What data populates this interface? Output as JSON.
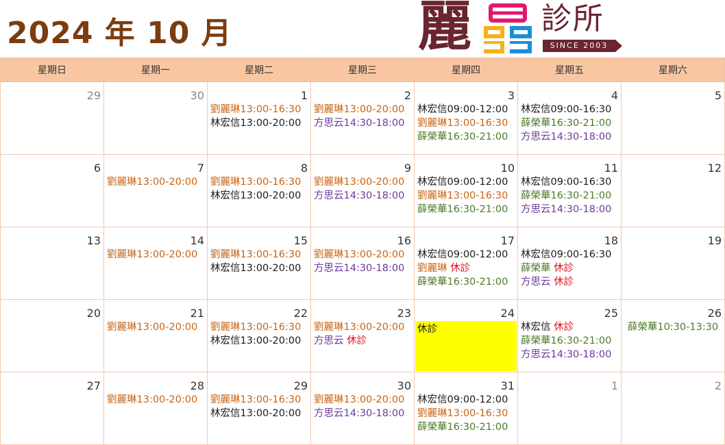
{
  "header": {
    "title": "2024 年 10 月",
    "logo": {
      "char1": "麗",
      "char2": "診所",
      "since": "SINCE 2003"
    }
  },
  "weekdays": [
    "星期日",
    "星期一",
    "星期二",
    "星期三",
    "星期四",
    "星期五",
    "星期六"
  ],
  "colors": {
    "liu": "#c86414",
    "lin": "#1a1a1a",
    "xue": "#4e7a2a",
    "fang": "#6a3a9a",
    "off": "#e0101c",
    "header_bg": "#f8c7a2",
    "title": "#7a3d10",
    "highlight": "#ffff00"
  },
  "weeks": [
    [
      {
        "day": "29",
        "other": true,
        "entries": []
      },
      {
        "day": "30",
        "other": true,
        "entries": []
      },
      {
        "day": "1",
        "entries": [
          {
            "name": "劉麗琳13:00-16:30",
            "c": "liu"
          },
          {
            "name": "林宏信13:00-20:00",
            "c": "lin"
          }
        ]
      },
      {
        "day": "2",
        "entries": [
          {
            "name": "劉麗琳13:00-20:00",
            "c": "liu"
          },
          {
            "name": "方思云14:30-18:00",
            "c": "fang"
          }
        ]
      },
      {
        "day": "3",
        "entries": [
          {
            "name": "林宏信09:00-12:00",
            "c": "lin"
          },
          {
            "name": "劉麗琳13:00-16:30",
            "c": "liu"
          },
          {
            "name": "薛榮華16:30-21:00",
            "c": "xue"
          }
        ]
      },
      {
        "day": "4",
        "entries": [
          {
            "name": "林宏信09:00-16:30",
            "c": "lin"
          },
          {
            "name": "薛榮華16:30-21:00",
            "c": "xue"
          },
          {
            "name": "方思云14:30-18:00",
            "c": "fang"
          }
        ]
      },
      {
        "day": "5",
        "entries": []
      }
    ],
    [
      {
        "day": "6",
        "entries": []
      },
      {
        "day": "7",
        "entries": [
          {
            "name": "劉麗琳13:00-20:00",
            "c": "liu"
          }
        ]
      },
      {
        "day": "8",
        "entries": [
          {
            "name": "劉麗琳13:00-16:30",
            "c": "liu"
          },
          {
            "name": "林宏信13:00-20:00",
            "c": "lin"
          }
        ]
      },
      {
        "day": "9",
        "entries": [
          {
            "name": "劉麗琳13:00-20:00",
            "c": "liu"
          },
          {
            "name": "方思云14:30-18:00",
            "c": "fang"
          }
        ]
      },
      {
        "day": "10",
        "entries": [
          {
            "name": "林宏信09:00-12:00",
            "c": "lin"
          },
          {
            "name": "劉麗琳13:00-16:30",
            "c": "liu"
          },
          {
            "name": "薛榮華16:30-21:00",
            "c": "xue"
          }
        ]
      },
      {
        "day": "11",
        "entries": [
          {
            "name": "林宏信09:00-16:30",
            "c": "lin"
          },
          {
            "name": "薛榮華16:30-21:00",
            "c": "xue"
          },
          {
            "name": "方思云14:30-18:00",
            "c": "fang"
          }
        ]
      },
      {
        "day": "12",
        "entries": []
      }
    ],
    [
      {
        "day": "13",
        "entries": []
      },
      {
        "day": "14",
        "entries": [
          {
            "name": "劉麗琳13:00-20:00",
            "c": "liu"
          }
        ]
      },
      {
        "day": "15",
        "entries": [
          {
            "name": "劉麗琳13:00-16:30",
            "c": "liu"
          },
          {
            "name": "林宏信13:00-20:00",
            "c": "lin"
          }
        ]
      },
      {
        "day": "16",
        "entries": [
          {
            "name": "劉麗琳13:00-20:00",
            "c": "liu"
          },
          {
            "name": "方思云14:30-18:00",
            "c": "fang"
          }
        ]
      },
      {
        "day": "17",
        "entries": [
          {
            "name": "林宏信09:00-12:00",
            "c": "lin"
          },
          {
            "name": "劉麗琳 ",
            "c": "liu",
            "off": "休診"
          },
          {
            "name": "薛榮華16:30-21:00",
            "c": "xue"
          }
        ]
      },
      {
        "day": "18",
        "entries": [
          {
            "name": "林宏信09:00-16:30",
            "c": "lin"
          },
          {
            "name": "薛榮華 ",
            "c": "xue",
            "off": "休診"
          },
          {
            "name": "方思云 ",
            "c": "fang",
            "off": "休診"
          }
        ]
      },
      {
        "day": "19",
        "entries": []
      }
    ],
    [
      {
        "day": "20",
        "entries": []
      },
      {
        "day": "21",
        "entries": [
          {
            "name": "劉麗琳13:00-20:00",
            "c": "liu"
          }
        ]
      },
      {
        "day": "22",
        "entries": [
          {
            "name": "劉麗琳13:00-16:30",
            "c": "liu"
          },
          {
            "name": "林宏信13:00-20:00",
            "c": "lin"
          }
        ]
      },
      {
        "day": "23",
        "entries": [
          {
            "name": "劉麗琳13:00-20:00",
            "c": "liu"
          },
          {
            "name": "方思云 ",
            "c": "fang",
            "off": "休診"
          }
        ]
      },
      {
        "day": "24",
        "highlight": "休診",
        "entries": []
      },
      {
        "day": "25",
        "entries": [
          {
            "name": "林宏信 ",
            "c": "lin",
            "off": "休診"
          },
          {
            "name": "薛榮華16:30-21:00",
            "c": "xue"
          },
          {
            "name": "方思云14:30-18:00",
            "c": "fang"
          }
        ]
      },
      {
        "day": "26",
        "entries": [
          {
            "name": "薛榮華10:30-13:30",
            "c": "xue",
            "center": true
          }
        ]
      }
    ],
    [
      {
        "day": "27",
        "entries": []
      },
      {
        "day": "28",
        "entries": [
          {
            "name": "劉麗琳13:00-20:00",
            "c": "liu"
          }
        ]
      },
      {
        "day": "29",
        "entries": [
          {
            "name": "劉麗琳13:00-16:30",
            "c": "liu"
          },
          {
            "name": "林宏信13:00-20:00",
            "c": "lin"
          }
        ]
      },
      {
        "day": "30",
        "entries": [
          {
            "name": "劉麗琳13:00-20:00",
            "c": "liu"
          },
          {
            "name": "方思云14:30-18:00",
            "c": "fang"
          }
        ]
      },
      {
        "day": "31",
        "entries": [
          {
            "name": "林宏信09:00-12:00",
            "c": "lin"
          },
          {
            "name": "劉麗琳13:00-16:30",
            "c": "liu"
          },
          {
            "name": "薛榮華16:30-21:00",
            "c": "xue"
          }
        ]
      },
      {
        "day": "1",
        "other": true,
        "entries": []
      },
      {
        "day": "2",
        "other": true,
        "entries": []
      }
    ]
  ]
}
